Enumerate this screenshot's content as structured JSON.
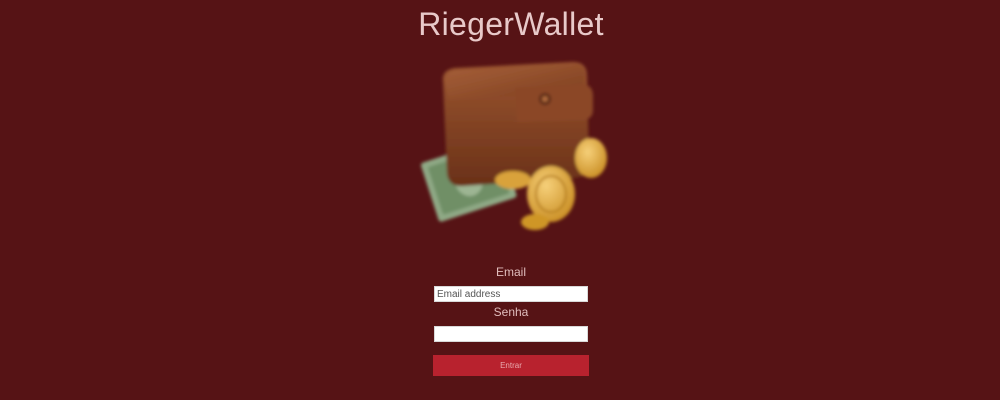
{
  "app": {
    "title": "RiegerWallet"
  },
  "logo": {
    "icon": "wallet-with-coins-icon"
  },
  "form": {
    "email_label": "Email",
    "email_value": "",
    "email_placeholder": "Email address",
    "password_label": "Senha",
    "password_value": "",
    "login_label": "Entrar"
  },
  "colors": {
    "background": "#561315",
    "title": "#e8c9c9",
    "button": "#b8222e",
    "wallet": "#7a3d1e",
    "coin": "#e2aa3a",
    "bill": "#6f8f66"
  }
}
